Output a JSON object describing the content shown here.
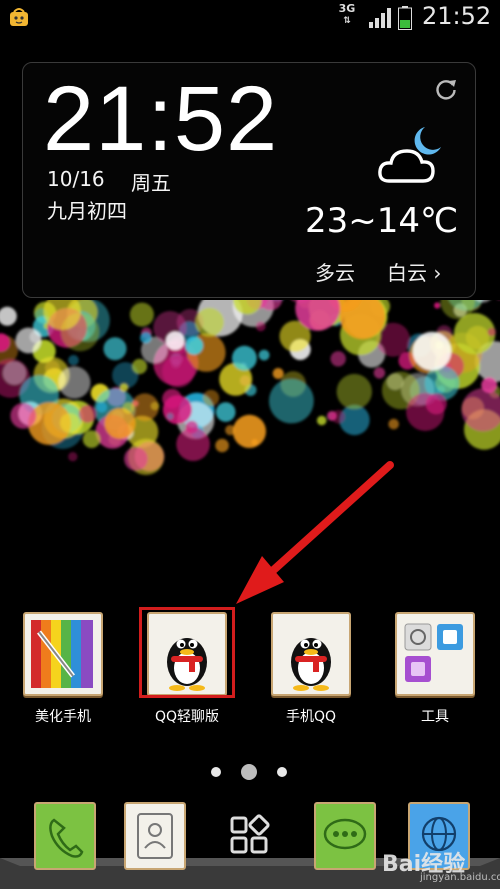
{
  "status_bar": {
    "network_type": "3G",
    "time": "21:52"
  },
  "clock_widget": {
    "time": "21:52",
    "date": "10/16",
    "weekday": "周五",
    "lunar_date": "九月初四",
    "temperature": "23~14℃",
    "condition": "多云",
    "city": "白云 ›"
  },
  "apps": [
    {
      "label": "美化手机",
      "icon": "palette-icon"
    },
    {
      "label": "QQ轻聊版",
      "icon": "qq-penguin-icon"
    },
    {
      "label": "手机QQ",
      "icon": "qq-penguin-icon"
    },
    {
      "label": "工具",
      "icon": "tools-folder-icon"
    }
  ],
  "page_indicator": {
    "pages": 3,
    "current": 2
  },
  "dock": [
    {
      "icon": "phone-icon"
    },
    {
      "icon": "contacts-icon"
    },
    {
      "icon": "app-drawer-icon"
    },
    {
      "icon": "messages-icon"
    },
    {
      "icon": "browser-globe-icon"
    }
  ],
  "watermark": {
    "brand": "Bai经验",
    "url": "jingyan.baidu.com"
  },
  "colors": {
    "highlight": "#d21d1d",
    "arrow": "#e01b1b",
    "tile_border": "#c8a673"
  }
}
